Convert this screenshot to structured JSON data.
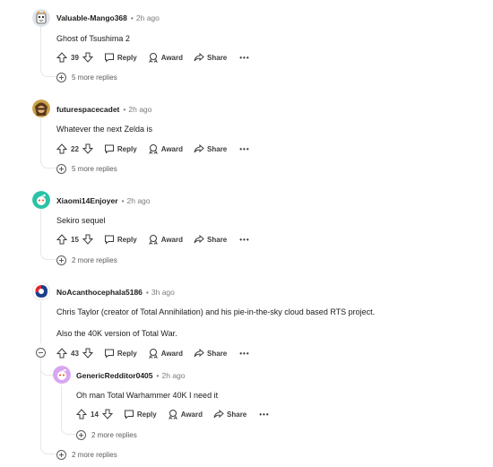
{
  "actions": {
    "reply": "Reply",
    "award": "Award",
    "share": "Share",
    "more": "•••"
  },
  "comments": [
    {
      "username": "Valuable-Mango368",
      "time": "2h ago",
      "body": [
        "Ghost of Tsushima 2"
      ],
      "votes": "39",
      "more_replies": "5 more replies"
    },
    {
      "username": "futurespacecadet",
      "time": "2h ago",
      "body": [
        "Whatever the next Zelda is"
      ],
      "votes": "22",
      "more_replies": "5 more replies"
    },
    {
      "username": "Xiaomi14Enjoyer",
      "time": "2h ago",
      "body": [
        "Sekiro sequel"
      ],
      "votes": "15",
      "more_replies": "2 more replies"
    },
    {
      "username": "NoAcanthocephala5186",
      "time": "3h ago",
      "body": [
        "Chris Taylor (creator of Total Annihilation) and his pie-in-the-sky cloud based RTS project.",
        "Also the 40K version of Total War."
      ],
      "votes": "43",
      "more_replies": "2 more replies",
      "reply": {
        "username": "GenericRedditor0405",
        "time": "2h ago",
        "body": [
          "Oh man Total Warhammer 40K I need it"
        ],
        "votes": "14",
        "more_replies": "2 more replies"
      }
    }
  ]
}
